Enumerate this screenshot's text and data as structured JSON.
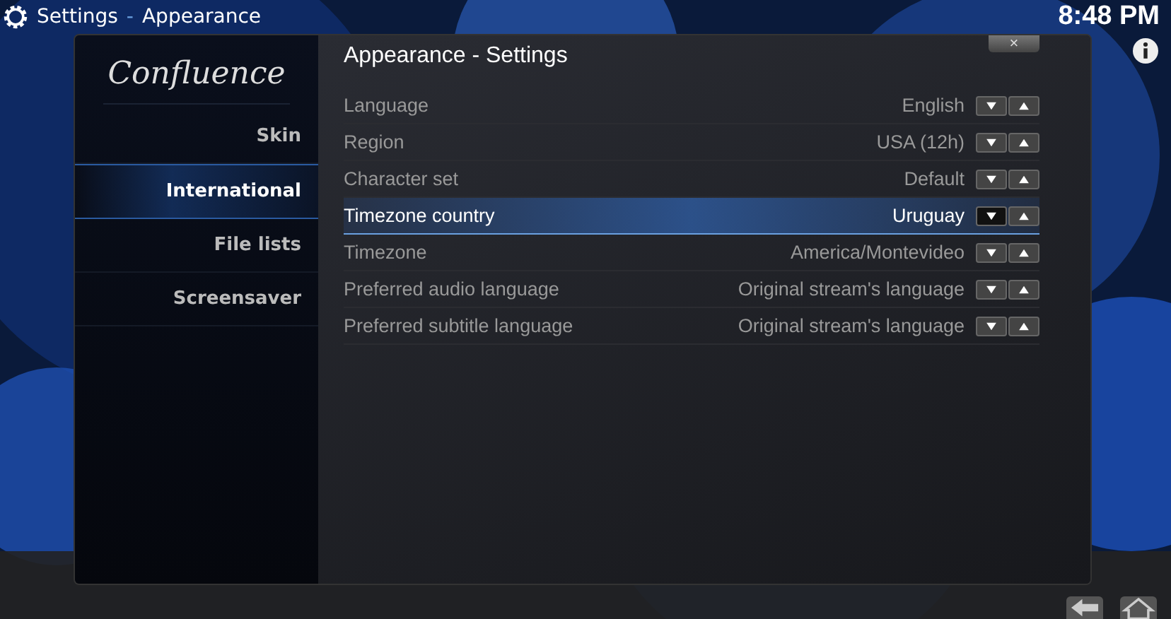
{
  "header": {
    "title": "Settings",
    "separator": "-",
    "subtitle": "Appearance",
    "clock": "8:48 PM"
  },
  "sidebar": {
    "logo": "Confluence",
    "items": [
      {
        "label": "Skin",
        "selected": false
      },
      {
        "label": "International",
        "selected": true
      },
      {
        "label": "File lists",
        "selected": false
      },
      {
        "label": "Screensaver",
        "selected": false
      }
    ]
  },
  "content": {
    "title": "Appearance - Settings",
    "close": "×",
    "settings": [
      {
        "label": "Language",
        "value": "English",
        "selected": false
      },
      {
        "label": "Region",
        "value": "USA (12h)",
        "selected": false
      },
      {
        "label": "Character set",
        "value": "Default",
        "selected": false
      },
      {
        "label": "Timezone country",
        "value": "Uruguay",
        "selected": true
      },
      {
        "label": "Timezone",
        "value": "America/Montevideo",
        "selected": false
      },
      {
        "label": "Preferred audio language",
        "value": "Original stream's language",
        "selected": false
      },
      {
        "label": "Preferred subtitle language",
        "value": "Original stream's language",
        "selected": false
      }
    ]
  }
}
